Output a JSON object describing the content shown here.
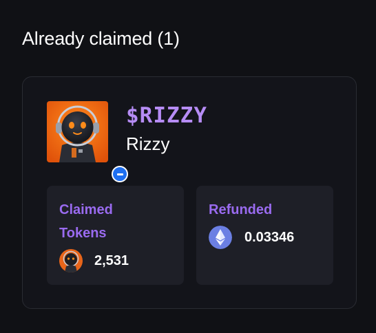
{
  "section": {
    "title": "Already claimed (1)"
  },
  "token": {
    "ticker": "$RIZZY",
    "name": "Rizzy",
    "avatar_icon": "robot-astronaut-avatar",
    "chain_badge_icon": "chain-badge-icon"
  },
  "stats": {
    "claimed": {
      "label": "Claimed Tokens",
      "value": "2,531",
      "icon": "rizzy-token-icon"
    },
    "refunded": {
      "label": "Refunded",
      "value": "0.03346",
      "icon": "ethereum-icon"
    }
  },
  "colors": {
    "background": "#101115",
    "card_border": "#2a2c33",
    "stat_background": "#1e1f27",
    "ticker": "#b68cf5",
    "stat_label": "#9a6bf0",
    "chain_badge": "#1e6ff0",
    "ethereum": "#6b7fe3"
  }
}
